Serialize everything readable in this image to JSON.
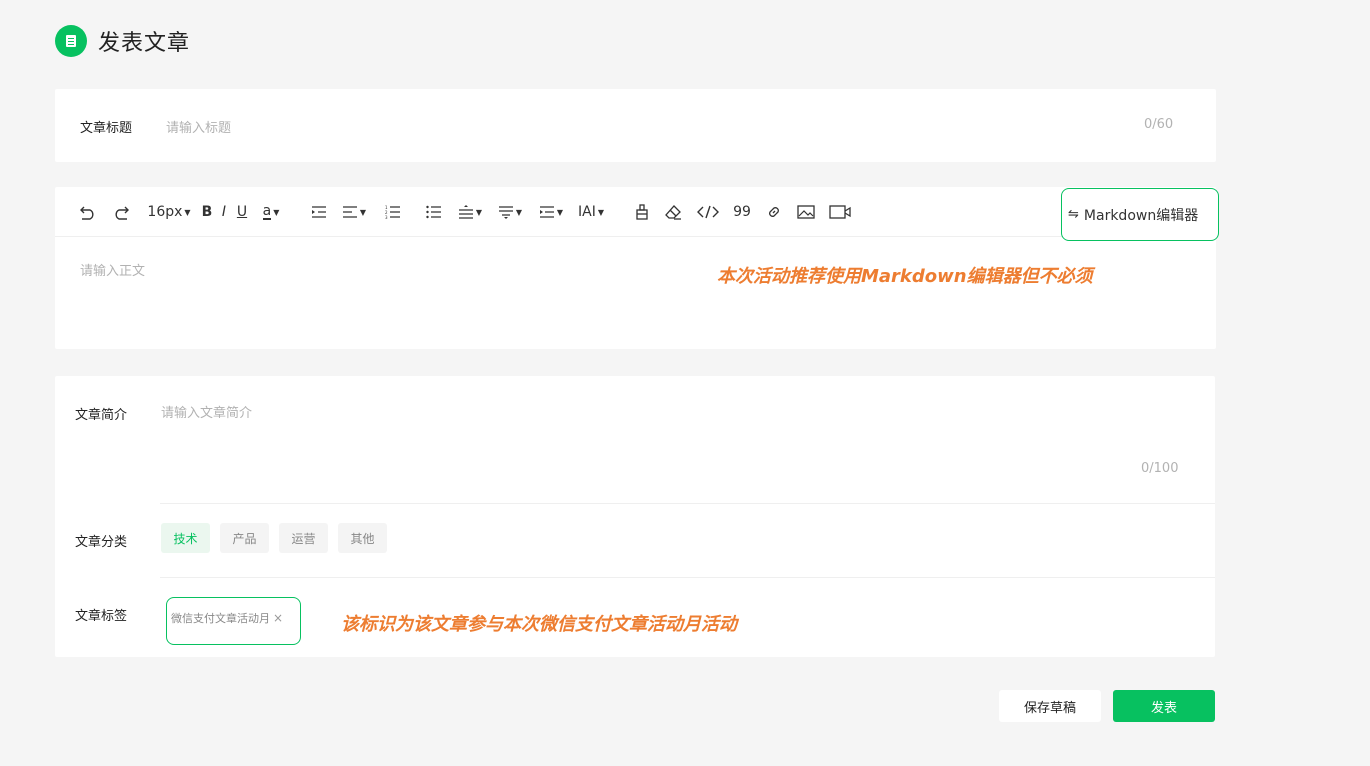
{
  "header": {
    "title": "发表文章",
    "logo_icon": "document-icon"
  },
  "title_field": {
    "label": "文章标题",
    "placeholder": "请输入标题",
    "counter": "0/60"
  },
  "toolbar": {
    "undo_icon": "undo-icon",
    "redo_icon": "redo-icon",
    "font_size": "16px",
    "bold": "B",
    "italic": "I",
    "underline": "U",
    "font_color": "a",
    "quote": "99",
    "font_family": "IAI",
    "markdown_label": "Markdown编辑器",
    "markdown_icon": "⇋"
  },
  "body_field": {
    "placeholder": "请输入正文"
  },
  "annotations": {
    "editor_note": "本次活动推荐使用Markdown编辑器但不必须",
    "tag_note": "该标识为该文章参与本次微信支付文章活动月活动"
  },
  "summary_field": {
    "label": "文章简介",
    "placeholder": "请输入文章简介",
    "counter": "0/100"
  },
  "category": {
    "label": "文章分类",
    "options": [
      "技术",
      "产品",
      "运营",
      "其他"
    ],
    "selected": "技术"
  },
  "tags": {
    "label": "文章标签",
    "items": [
      {
        "text": "微信支付文章活动月",
        "remove": "×"
      }
    ]
  },
  "actions": {
    "save_draft": "保存草稿",
    "publish": "发表"
  },
  "colors": {
    "accent": "#07c160",
    "annotation": "#ed7d31",
    "background": "#f5f5f5"
  }
}
